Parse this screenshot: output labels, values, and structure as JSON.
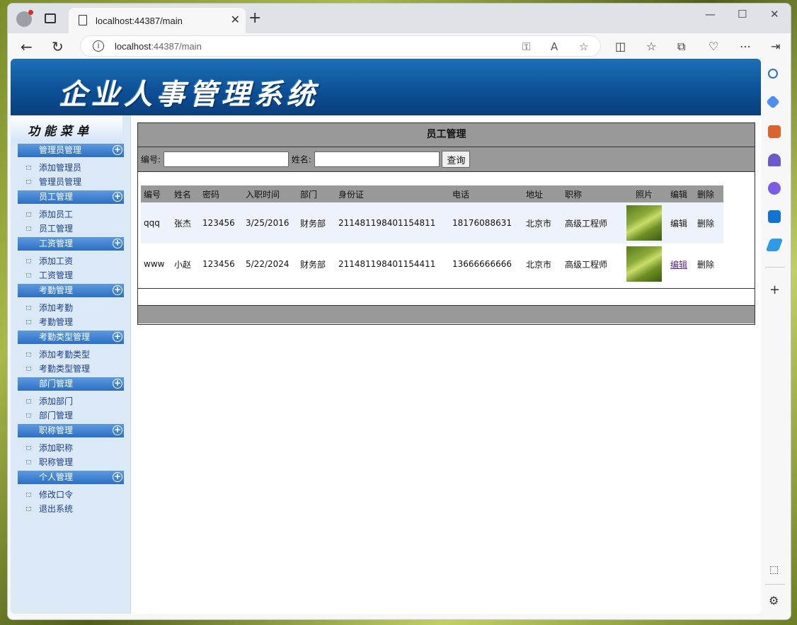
{
  "browser": {
    "tab_title": "localhost:44387/main",
    "tab_close": "✕",
    "new_tab": "+",
    "url_host": "localhost",
    "url_rest": ":44387/main",
    "win_minimize": "—",
    "win_maximize": "☐",
    "win_close": "✕"
  },
  "header": {
    "logo_text": "企业人事管理系统"
  },
  "menu": {
    "title": "功能菜单",
    "groups": [
      {
        "label": "管理员管理",
        "items": [
          "添加管理员",
          "管理员管理"
        ]
      },
      {
        "label": "员工管理",
        "items": [
          "添加员工",
          "员工管理"
        ]
      },
      {
        "label": "工资管理",
        "items": [
          "添加工资",
          "工资管理"
        ]
      },
      {
        "label": "考勤管理",
        "items": [
          "添加考勤",
          "考勤管理"
        ]
      },
      {
        "label": "考勤类型管理",
        "items": [
          "添加考勤类型",
          "考勤类型管理"
        ]
      },
      {
        "label": "部门管理",
        "items": [
          "添加部门",
          "部门管理"
        ]
      },
      {
        "label": "职称管理",
        "items": [
          "添加职称",
          "职称管理"
        ]
      },
      {
        "label": "个人管理",
        "items": [
          "修改口令",
          "退出系统"
        ]
      }
    ]
  },
  "panel": {
    "title": "员工管理",
    "search": {
      "id_label": "编号:",
      "id_value": "",
      "name_label": "姓名:",
      "name_value": "",
      "button_label": "查询"
    },
    "table": {
      "columns": [
        "编号",
        "姓名",
        "密码",
        "入职时间",
        "部门",
        "身份证",
        "电话",
        "地址",
        "职称",
        "照片",
        "编辑",
        "删除"
      ],
      "rows": [
        {
          "id": "qqq",
          "name": "张杰",
          "password": "123456",
          "hire_date": "3/25/2016",
          "dept": "财务部",
          "id_card": "211481198401154811",
          "phone": "18176088631",
          "address": "北京市",
          "title": "高级工程师",
          "edit": "编辑",
          "delete": "删除"
        },
        {
          "id": "www",
          "name": "小赵",
          "password": "123456",
          "hire_date": "5/22/2024",
          "dept": "财务部",
          "id_card": "211481198401154411",
          "phone": "13666666666",
          "address": "北京市",
          "title": "高级工程师",
          "edit": "编辑",
          "delete": "删除"
        }
      ]
    }
  }
}
